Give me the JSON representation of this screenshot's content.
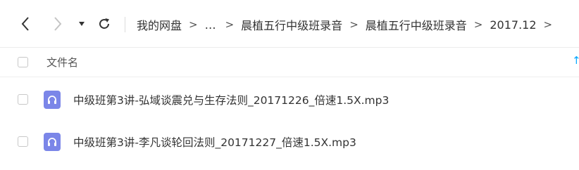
{
  "toolbar": {
    "back_icon": "chevron-left-icon",
    "forward_icon": "chevron-right-icon",
    "dropdown_icon": "caret-down-icon",
    "refresh_icon": "refresh-icon"
  },
  "breadcrumb": {
    "items": [
      "我的网盘",
      "…",
      "晨植五行中级班录音",
      "晨植五行中级班录音",
      "2017.12"
    ],
    "separator": ">"
  },
  "list": {
    "column_name": "文件名",
    "sort_icon": "sort-ascending-icon",
    "files": [
      {
        "name": "中级班第3讲-弘域谈震兑与生存法则_20171226_倍速1.5X.mp3",
        "icon": "audio-file-icon"
      },
      {
        "name": "中级班第3讲-李凡谈轮回法则_20171227_倍速1.5X.mp3",
        "icon": "audio-file-icon"
      }
    ]
  },
  "colors": {
    "accent": "#06a7ff",
    "audio_icon": "#7b86e8",
    "text": "#333333",
    "divider": "#ececec"
  }
}
